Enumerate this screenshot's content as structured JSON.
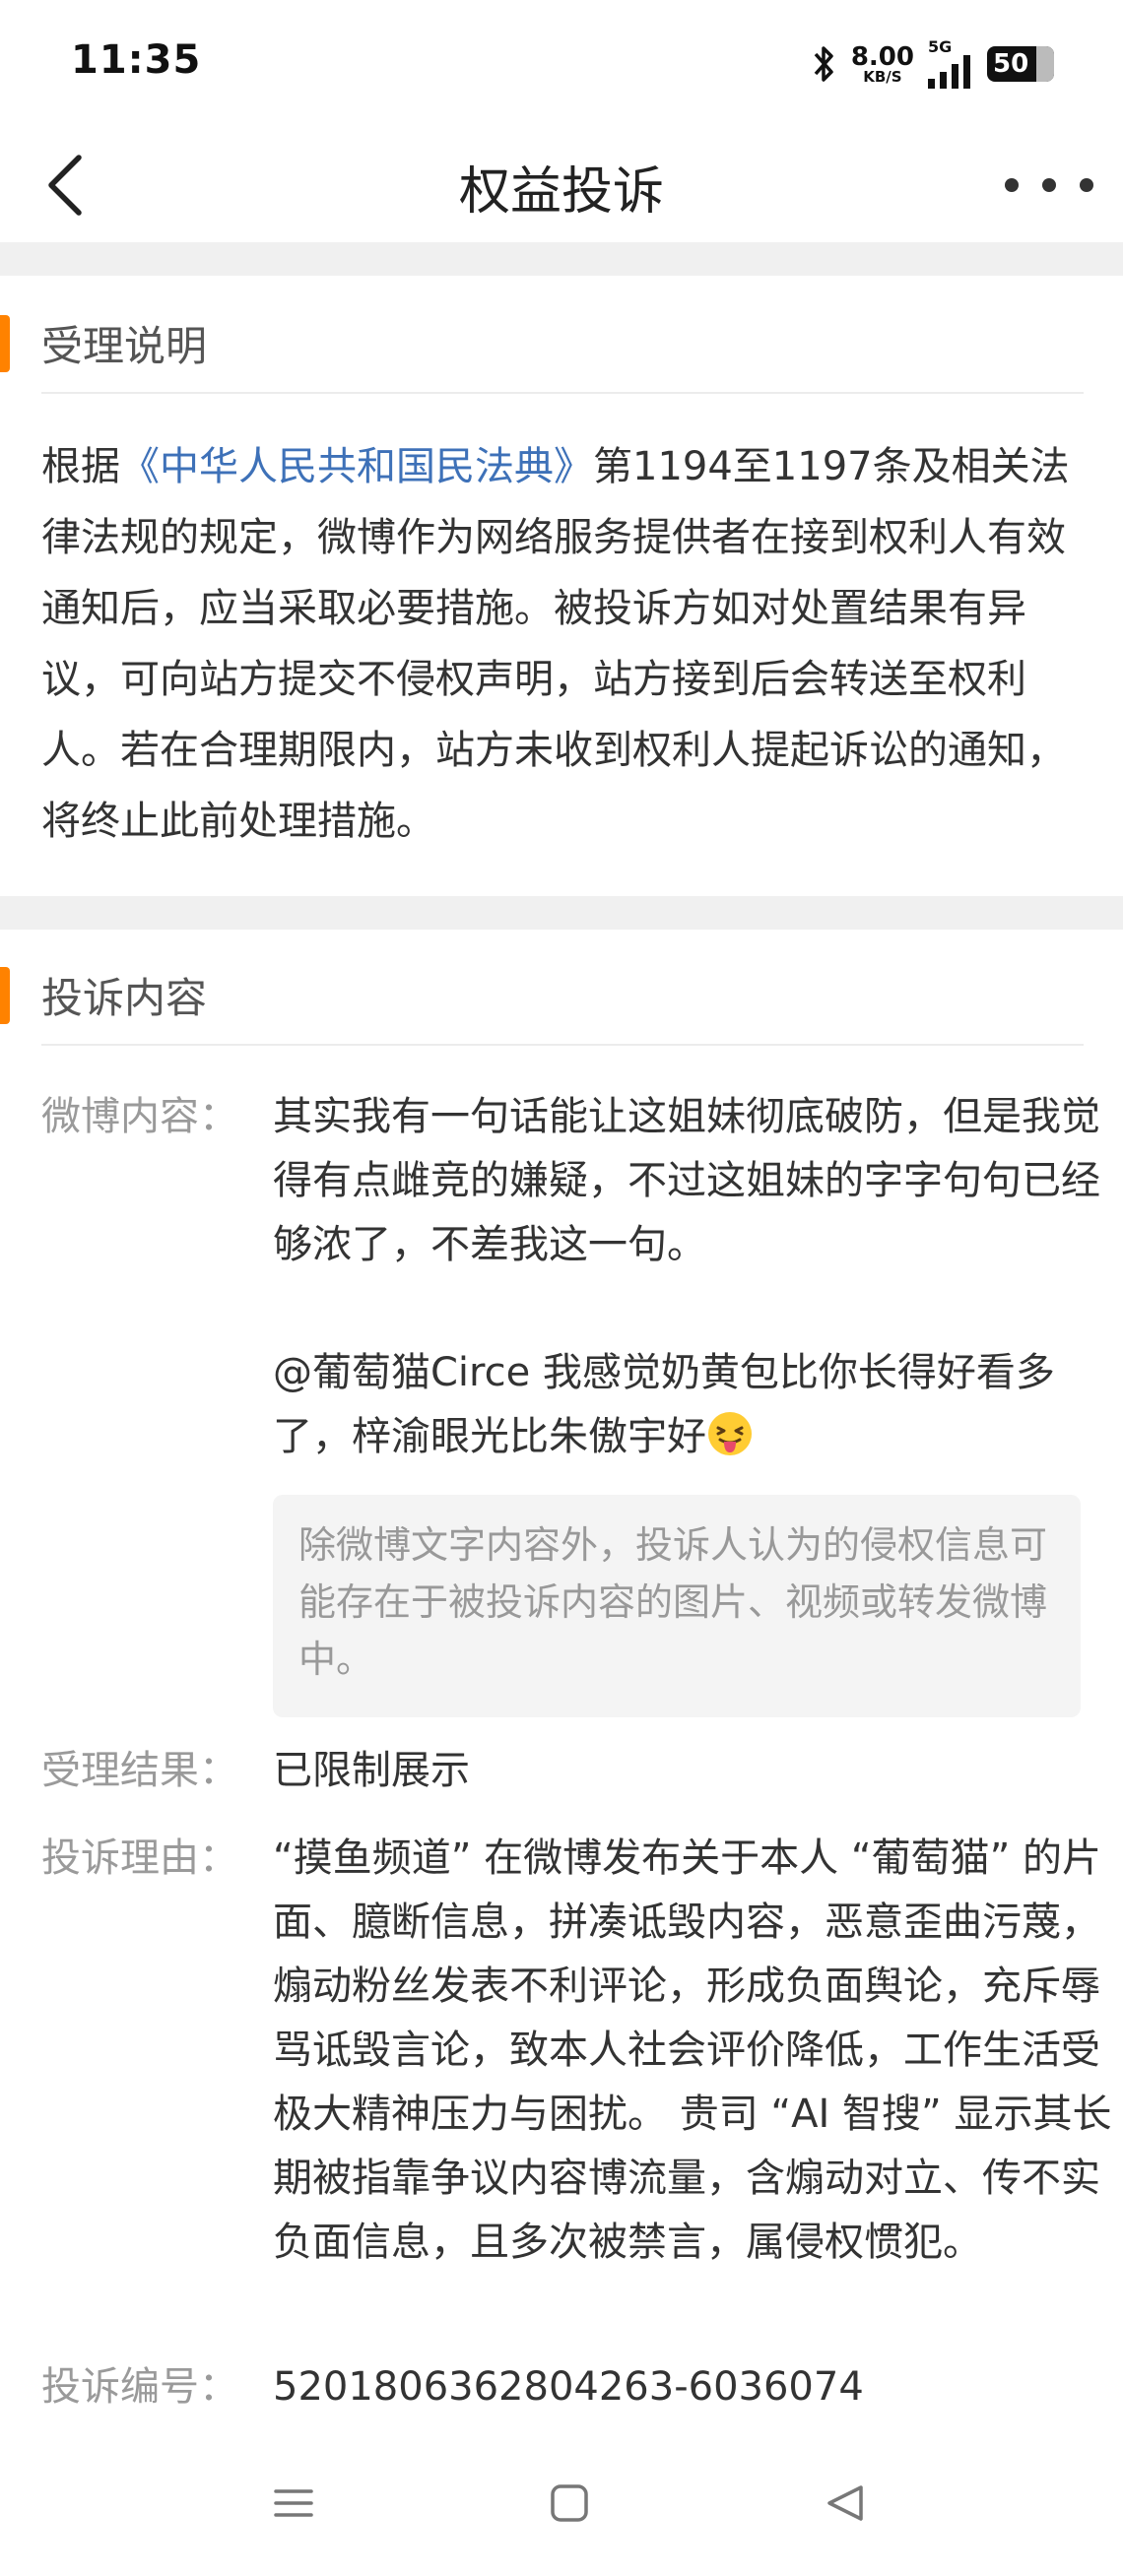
{
  "status_bar": {
    "time": "11:35",
    "net_speed_value": "8.00",
    "net_speed_unit": "KB/S",
    "network": "5G",
    "battery": "50",
    "icons": [
      "bluetooth-icon",
      "signal-icon",
      "battery-icon"
    ]
  },
  "nav": {
    "title": "权益投诉"
  },
  "notice": {
    "section_title": "受理说明",
    "text_before_link": "根据",
    "link_text": "《中华人民共和国民法典》",
    "text_after_link": "第1194至1197条及相关法律法规的规定，微博作为网络服务提供者在接到权利人有效通知后，应当采取必要措施。被投诉方如对处置结果有异议，可向站方提交不侵权声明，站方接到后会转送至权利人。若在合理期限内，站方未收到权利人提起诉讼的通知，将终止此前处理措施。"
  },
  "complaint": {
    "section_title": "投诉内容",
    "weibo_label": "微博内容：",
    "weibo_para1": "其实我有一句话能让这姐妹彻底破防，但是我觉得有点雌竞的嫌疑，不过这姐妹的字字句句已经够浓了，不差我这一句。",
    "weibo_para2": "@葡萄猫Circe 我感觉奶黄包比你长得好看多了，梓渝眼光比朱傲宇好",
    "emoji_icon": "tongue-out-emoji-icon",
    "tip": "除微博文字内容外，投诉人认为的侵权信息可能存在于被投诉内容的图片、视频或转发微博中。",
    "result_label": "受理结果：",
    "result_value": "已限制展示",
    "reason_label": "投诉理由：",
    "reason_value": "“摸鱼频道” 在微博发布关于本人 “葡萄猫” 的片面、臆断信息，拼凑诋毁内容，恶意歪曲污蔑，煽动粉丝发表不利评论，形成负面舆论，充斥辱骂诋毁言论，致本人社会评价降低，工作生活受极大精神压力与困扰。 贵司 “AI 智搜” 显示其长期被指靠争议内容博流量，含煽动对立、传不实负面信息，且多次被禁言，属侵权惯犯。",
    "id_label": "投诉编号：",
    "id_value": "5201806362804263-6036074"
  },
  "colors": {
    "accent": "#ff8200",
    "link": "#3e71b8",
    "label_gray": "#9a9a9a",
    "band": "#f0f0f0"
  }
}
